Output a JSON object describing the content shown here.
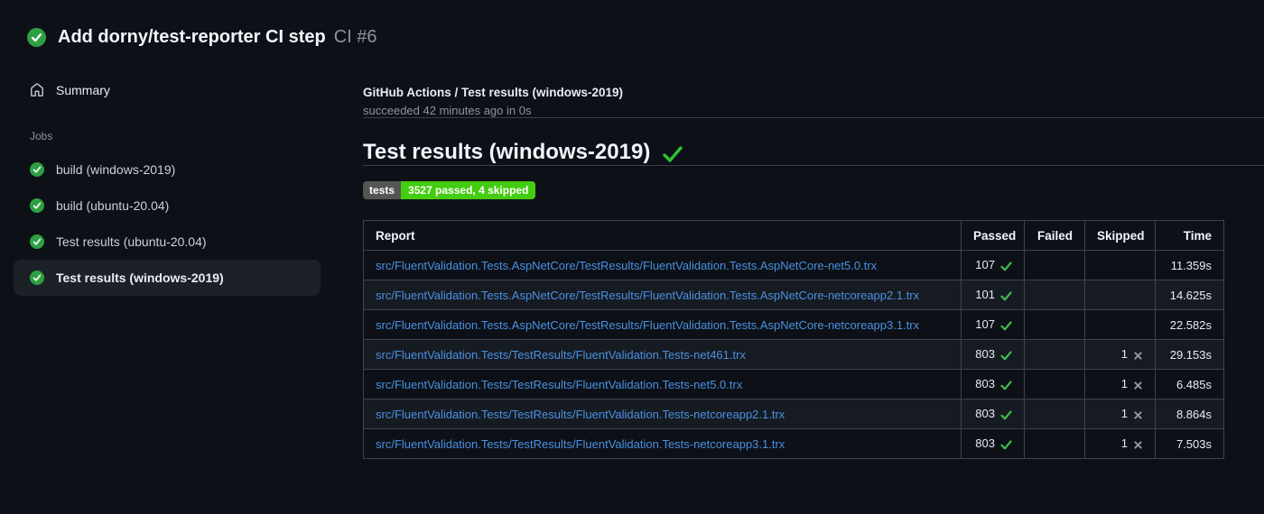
{
  "header": {
    "title": "Add dorny/test-reporter CI step",
    "run_number": "CI #6"
  },
  "sidebar": {
    "summary_label": "Summary",
    "jobs_label": "Jobs",
    "jobs": [
      {
        "label": "build (windows-2019)",
        "selected": false
      },
      {
        "label": "build (ubuntu-20.04)",
        "selected": false
      },
      {
        "label": "Test results (ubuntu-20.04)",
        "selected": false
      },
      {
        "label": "Test results (windows-2019)",
        "selected": true
      }
    ]
  },
  "main": {
    "check_title": "GitHub Actions / Test results (windows-2019)",
    "check_status": "succeeded 42 minutes ago in 0s",
    "section_title": "Test results (windows-2019)",
    "badge": {
      "label": "tests",
      "value": "3527 passed, 4 skipped"
    },
    "table": {
      "columns": [
        "Report",
        "Passed",
        "Failed",
        "Skipped",
        "Time"
      ],
      "rows": [
        {
          "report": "src/FluentValidation.Tests.AspNetCore/TestResults/FluentValidation.Tests.AspNetCore-net5.0.trx",
          "passed": "107",
          "failed": "",
          "skipped": "",
          "time": "11.359s"
        },
        {
          "report": "src/FluentValidation.Tests.AspNetCore/TestResults/FluentValidation.Tests.AspNetCore-netcoreapp2.1.trx",
          "passed": "101",
          "failed": "",
          "skipped": "",
          "time": "14.625s"
        },
        {
          "report": "src/FluentValidation.Tests.AspNetCore/TestResults/FluentValidation.Tests.AspNetCore-netcoreapp3.1.trx",
          "passed": "107",
          "failed": "",
          "skipped": "",
          "time": "22.582s"
        },
        {
          "report": "src/FluentValidation.Tests/TestResults/FluentValidation.Tests-net461.trx",
          "passed": "803",
          "failed": "",
          "skipped": "1",
          "time": "29.153s"
        },
        {
          "report": "src/FluentValidation.Tests/TestResults/FluentValidation.Tests-net5.0.trx",
          "passed": "803",
          "failed": "",
          "skipped": "1",
          "time": "6.485s"
        },
        {
          "report": "src/FluentValidation.Tests/TestResults/FluentValidation.Tests-netcoreapp2.1.trx",
          "passed": "803",
          "failed": "",
          "skipped": "1",
          "time": "8.864s"
        },
        {
          "report": "src/FluentValidation.Tests/TestResults/FluentValidation.Tests-netcoreapp3.1.trx",
          "passed": "803",
          "failed": "",
          "skipped": "1",
          "time": "7.503s"
        }
      ]
    }
  },
  "icons": {
    "run_status": "check-circle",
    "summary": "home",
    "job_status": "check-circle",
    "section_status": "check",
    "passed_mark": "check",
    "skipped_mark": "cross"
  },
  "colors": {
    "background": "#0d1117",
    "success_circle_green": "#2ea043",
    "check_mark_green": "#3fb950",
    "heading_check_green": "#2ec234",
    "cross_gray": "#8e969e",
    "link_blue": "#4a90e2",
    "badge_label_bg": "#555555",
    "badge_value_bg": "#44cc11",
    "muted_text": "#8b949e",
    "selected_item_bg": "#1c2128",
    "table_border": "#3d444d",
    "row_alt_bg": "#161b22"
  }
}
